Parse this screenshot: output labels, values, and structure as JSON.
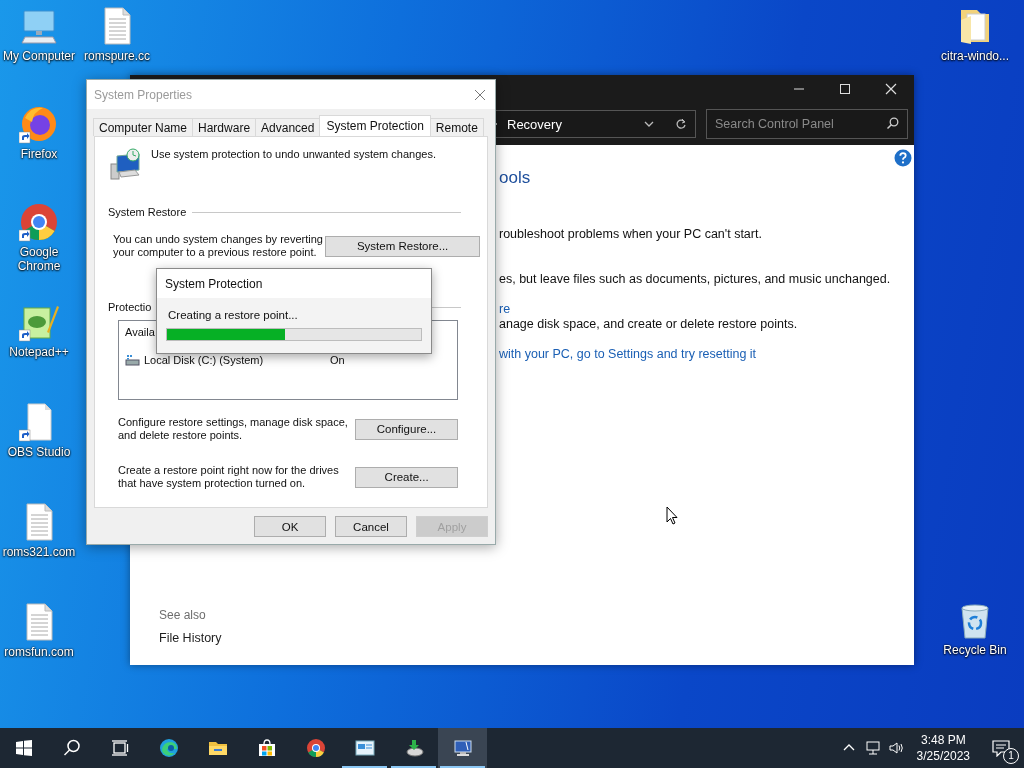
{
  "desktop_icons": [
    {
      "label": "My Computer",
      "kind": "computer",
      "shortcut": false
    },
    {
      "label": "romspure.cc",
      "kind": "document",
      "shortcut": false
    },
    {
      "label": "Firefox",
      "kind": "firefox",
      "shortcut": true
    },
    {
      "label": "Google Chrome",
      "kind": "chrome",
      "shortcut": true
    },
    {
      "label": "Notepad++",
      "kind": "notepad",
      "shortcut": true
    },
    {
      "label": "OBS Studio",
      "kind": "blank",
      "shortcut": true
    },
    {
      "label": "roms321.com",
      "kind": "document",
      "shortcut": false
    },
    {
      "label": "romsfun.com",
      "kind": "document",
      "shortcut": false
    },
    {
      "label": "citra-windo...",
      "kind": "folder",
      "shortcut": false
    },
    {
      "label": "Recycle Bin",
      "kind": "recycle",
      "shortcut": false
    }
  ],
  "control_panel": {
    "breadcrumb": "Recovery",
    "search": {
      "placeholder": "Search Control Panel"
    },
    "heading": "ools",
    "sections": [
      {
        "lines": [
          {
            "kind": "text",
            "text": "roubleshoot problems when your PC can't start."
          }
        ]
      },
      {
        "lines": [
          {
            "kind": "text",
            "text": "es, but leave files such as documents, pictures, and music unchanged."
          }
        ]
      },
      {
        "lines": [
          {
            "kind": "link",
            "text": "re"
          },
          {
            "kind": "text",
            "text": "anage disk space, and create or delete restore points."
          }
        ]
      },
      {
        "lines": [
          {
            "kind": "link",
            "text": "with your PC, go to Settings and try resetting it"
          }
        ]
      }
    ],
    "see_also": {
      "title": "See also",
      "links": [
        "File History"
      ]
    }
  },
  "system_properties": {
    "title": "System Properties",
    "tabs": [
      {
        "label": "Computer Name",
        "selected": false
      },
      {
        "label": "Hardware",
        "selected": false
      },
      {
        "label": "Advanced",
        "selected": false
      },
      {
        "label": "System Protection",
        "selected": true
      },
      {
        "label": "Remote",
        "selected": false
      }
    ],
    "intro": "Use system protection to undo unwanted system changes.",
    "system_restore": {
      "label": "System Restore",
      "text": "You can undo system changes by reverting your computer to a previous restore point.",
      "button": "System Restore..."
    },
    "protection": {
      "label": "Protectio",
      "list_header": "Availa",
      "drives": [
        {
          "name": "Local Disk (C:) (System)",
          "status": "On"
        }
      ]
    },
    "configure": {
      "text": "Configure restore settings, manage disk space, and delete restore points.",
      "button": "Configure..."
    },
    "create": {
      "text": "Create a restore point right now for the drives that have system protection turned on.",
      "button": "Create..."
    },
    "buttons": [
      {
        "label": "OK",
        "disabled": false
      },
      {
        "label": "Cancel",
        "disabled": false
      },
      {
        "label": "Apply",
        "disabled": true
      }
    ]
  },
  "progress_dialog": {
    "title": "System Protection",
    "message": "Creating a restore point...",
    "level": 0.465
  },
  "taskbar": {
    "apps": [
      {
        "kind": "start",
        "running": false,
        "selected": false
      },
      {
        "kind": "search",
        "running": false,
        "selected": false
      },
      {
        "kind": "task-view",
        "running": false,
        "selected": false
      },
      {
        "kind": "edge",
        "running": false,
        "selected": false
      },
      {
        "kind": "explorer",
        "running": false,
        "selected": false
      },
      {
        "kind": "store",
        "running": false,
        "selected": false
      },
      {
        "kind": "chrome",
        "running": false,
        "selected": false
      },
      {
        "kind": "control-panel",
        "running": true,
        "selected": false
      },
      {
        "kind": "disk-tool",
        "running": true,
        "selected": false
      },
      {
        "kind": "system",
        "running": true,
        "selected": true
      }
    ],
    "clock": {
      "time": "3:48 PM",
      "date": "3/25/2023"
    },
    "notifications": "1"
  }
}
